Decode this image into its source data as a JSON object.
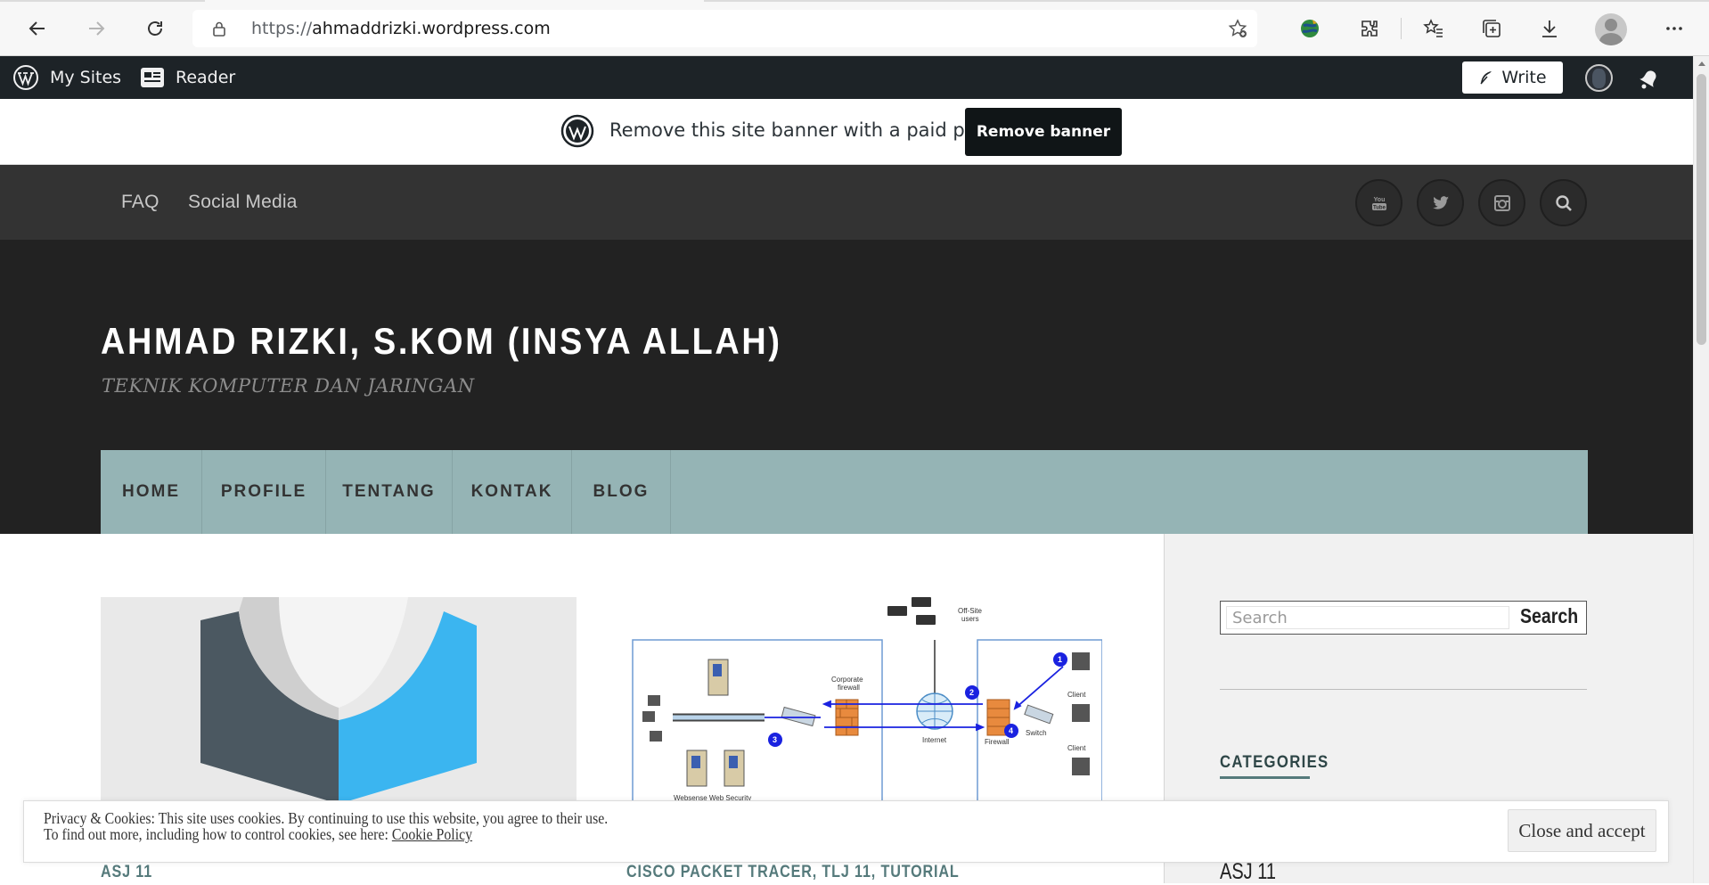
{
  "browser": {
    "url_prefix": "https://",
    "url_host": "ahmaddrizki.wordpress.com"
  },
  "wp_bar": {
    "my_sites": "My Sites",
    "reader": "Reader",
    "write": "Write"
  },
  "banner": {
    "message": "Remove this site banner with a paid plan",
    "button": "Remove banner"
  },
  "top_nav": {
    "links": [
      "FAQ",
      "Social Media"
    ],
    "social_icons": [
      "youtube-icon",
      "twitter-icon",
      "instagram-icon",
      "search-icon"
    ]
  },
  "site": {
    "title": "AHMAD RIZKI, S.KOM (INSYA ALLAH)",
    "tagline": "TEKNIK KOMPUTER DAN JARINGAN"
  },
  "main_nav": {
    "items": [
      "HOME",
      "PROFILE",
      "TENTANG",
      "KONTAK",
      "BLOG"
    ]
  },
  "posts": [
    {
      "title": "ASJ 11"
    },
    {
      "title": "CISCO PACKET TRACER, TLJ 11, TUTORIAL"
    }
  ],
  "diagram_labels": {
    "offsite": "Off-Site\nusers",
    "corporate_firewall": "Corporate\nfirewall",
    "internet": "Internet",
    "firewall": "Firewall",
    "switch": "Switch",
    "client": "Client",
    "websense": "Websense Web Security",
    "num1": "1",
    "num2": "2",
    "num3": "3",
    "num4": "4"
  },
  "sidebar": {
    "search_placeholder": "Search",
    "search_button": "Search",
    "categories_heading": "CATEGORIES",
    "category_items": [
      "ASJ 11"
    ]
  },
  "cookie": {
    "line1": "Privacy & Cookies: This site uses cookies. By continuing to use this website, you agree to their use.",
    "line2_prefix": "To find out more, including how to control cookies, see here: ",
    "line2_link": "Cookie Policy",
    "button": "Close and accept"
  },
  "colors": {
    "admin_bar": "#1d2327",
    "top_nav": "#333333",
    "header": "#222222",
    "main_nav": "#95b4b5",
    "accent": "#557a7b"
  }
}
